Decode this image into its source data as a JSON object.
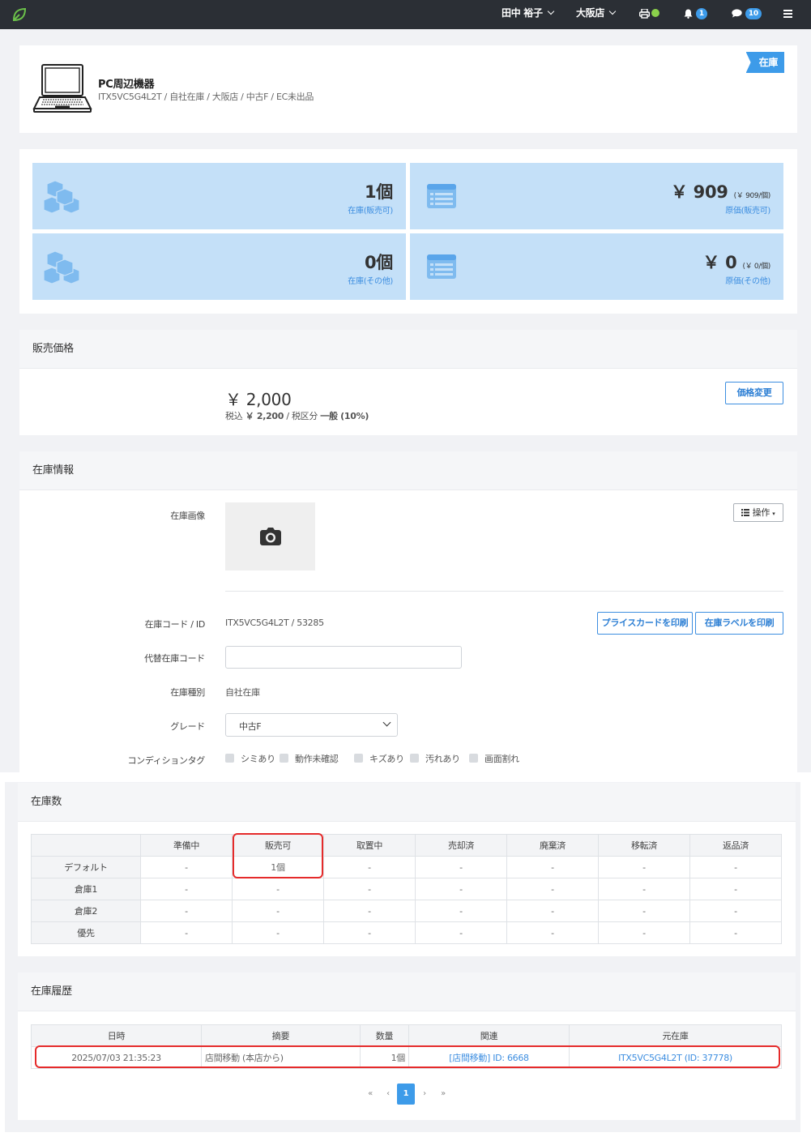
{
  "topbar": {
    "user": "田中 裕子",
    "store": "大阪店",
    "notifications": "1",
    "messages": "10"
  },
  "product": {
    "name": "PC周辺機器",
    "meta": "ITX5VC5G4L2T / 自社在庫 / 大阪店 / 中古F / EC未出品",
    "status_ribbon": "在庫"
  },
  "stats": [
    {
      "value": "1個",
      "label": "在庫(販売可)"
    },
    {
      "value": "￥ 909",
      "sub": "(￥ 909/個)",
      "label": "原価(販売可)"
    },
    {
      "value": "0個",
      "label": "在庫(その他)"
    },
    {
      "value": "￥ 0",
      "sub": "(￥ 0/個)",
      "label": "原価(その他)"
    }
  ],
  "price": {
    "title": "販売価格",
    "amount": "￥ 2,000",
    "tax_prefix": "税込",
    "tax_amount": "￥ 2,200",
    "tax_suffix": "/ 税区分",
    "tax_class": "一般 (10%)",
    "change_button": "価格変更"
  },
  "stock_info": {
    "title": "在庫情報",
    "image_label": "在庫画像",
    "ops_button": "操作",
    "code_label": "在庫コード / ID",
    "code_value": "ITX5VC5G4L2T / 53285",
    "price_card_button": "プライスカードを印刷",
    "stock_label_button": "在庫ラベルを印刷",
    "alt_code_label": "代替在庫コード",
    "alt_code_value": "",
    "type_label": "在庫種別",
    "type_value": "自社在庫",
    "grade_label": "グレード",
    "grade_value": "中古F",
    "condition_label": "コンディションタグ",
    "condition_tags": [
      "シミあり",
      "動作未確認",
      "キズあり",
      "汚れあり",
      "画面割れ"
    ]
  },
  "stock_count": {
    "title": "在庫数",
    "columns": [
      "準備中",
      "販売可",
      "取置中",
      "売却済",
      "廃棄済",
      "移転済",
      "返品済"
    ],
    "rows": [
      {
        "name": "デフォルト",
        "cells": [
          "-",
          "1個",
          "-",
          "-",
          "-",
          "-",
          "-"
        ]
      },
      {
        "name": "倉庫1",
        "cells": [
          "-",
          "-",
          "-",
          "-",
          "-",
          "-",
          "-"
        ]
      },
      {
        "name": "倉庫2",
        "cells": [
          "-",
          "-",
          "-",
          "-",
          "-",
          "-",
          "-"
        ]
      },
      {
        "name": "優先",
        "cells": [
          "-",
          "-",
          "-",
          "-",
          "-",
          "-",
          "-"
        ]
      }
    ]
  },
  "history": {
    "title": "在庫履歴",
    "columns": [
      "日時",
      "摘要",
      "数量",
      "関連",
      "元在庫"
    ],
    "rows": [
      {
        "datetime": "2025/07/03 21:35:23",
        "summary": "店間移動 (本店から)",
        "qty": "1個",
        "related": "[店間移動] ID: 6668",
        "origin": "ITX5VC5G4L2T (ID: 37778)"
      }
    ],
    "pagination": {
      "first": "«",
      "prev": "‹",
      "current": "1",
      "next": "›",
      "last": "»"
    }
  },
  "colors": {
    "accent": "#3d9be9",
    "stat_bg": "#c4e0f8",
    "topbar": "#2b2f35",
    "highlight": "#e52b2b"
  }
}
